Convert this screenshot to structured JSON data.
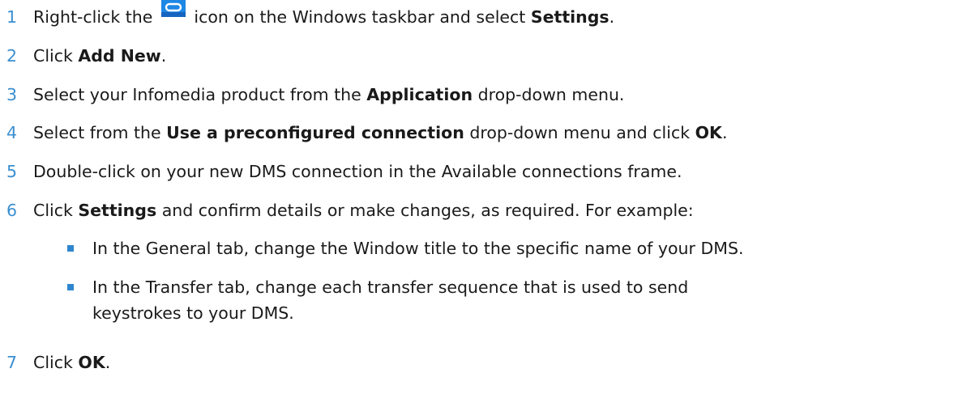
{
  "steps": [
    {
      "number": "1",
      "before": "Right-click the",
      "after": "icon on the Windows taskbar and select",
      "bold": "Settings",
      "end": "."
    },
    {
      "number": "2",
      "before": "Click",
      "bold": "Add New",
      "end": "."
    },
    {
      "number": "3",
      "before": "Select your Infomedia product from the",
      "bold": "Application",
      "end": "drop-down menu."
    },
    {
      "number": "4",
      "before": "Select from the",
      "bold": "Use a preconfigured connection",
      "middle": "drop-down menu and click",
      "bold2": "OK",
      "end": "."
    },
    {
      "number": "5",
      "text": "Double-click on your new DMS connection in the Available connections frame."
    },
    {
      "number": "6",
      "before": "Click",
      "bold": "Settings",
      "end": "and confirm details or make changes, as required. For example:"
    },
    {
      "number": "7",
      "before": "Click",
      "bold": "OK",
      "end": "."
    }
  ],
  "substeps": [
    {
      "text": "In the General tab, change the Window title to the specific name of your DMS."
    },
    {
      "line1": "In the Transfer tab, change each transfer sequence that is used to send",
      "line2": "keystrokes to your DMS."
    }
  ],
  "icons": {
    "taskbar_icon": "link-icon"
  },
  "colors": {
    "step_number": "#3b8fd0",
    "bullet": "#2f86cf",
    "icon_bg": "#1e88e5"
  }
}
